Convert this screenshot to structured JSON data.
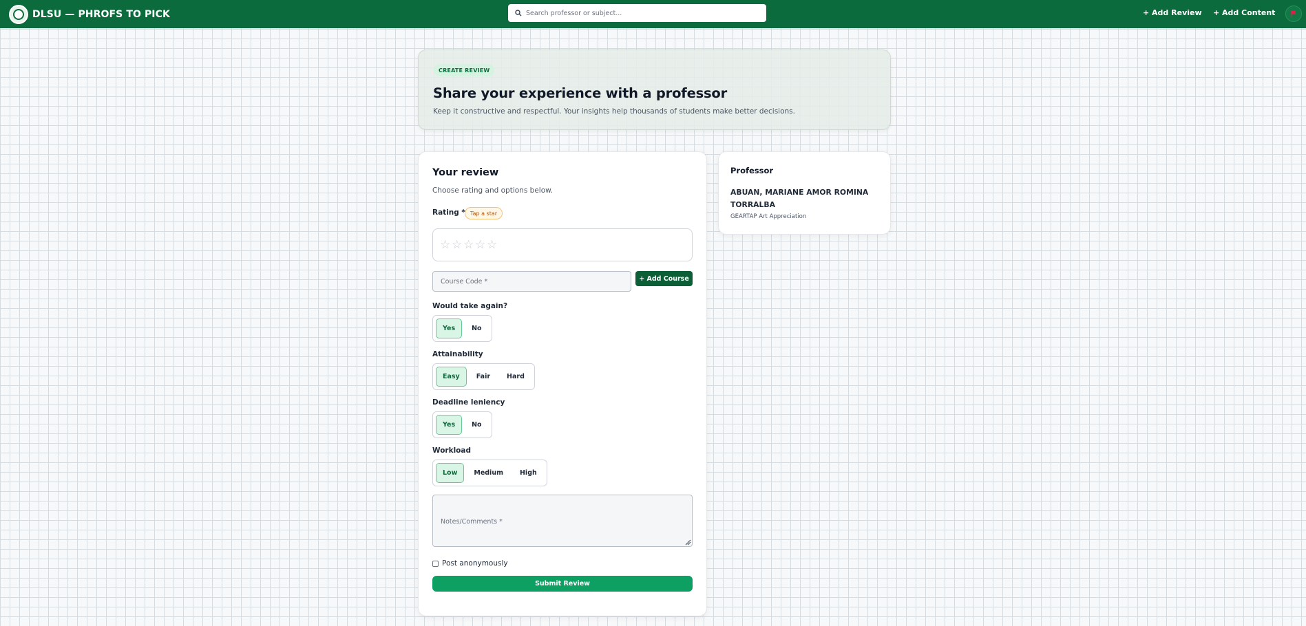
{
  "header": {
    "brand": "DLSU — PHROFS TO PICK",
    "search_placeholder": "Search professor or subject...",
    "nav": {
      "add_review": "+ Add Review",
      "add_content": "+ Add Content"
    },
    "bar_color": "#0b6b3c"
  },
  "hero": {
    "badge": "CREATE REVIEW",
    "title": "Share your experience with a professor",
    "subtitle": "Keep it constructive and respectful. Your insights help thousands of students make better decisions."
  },
  "review": {
    "title": "Your review",
    "subtitle": "Choose rating and options below.",
    "rating_label": "Rating *",
    "rating_hint": "Tap a star",
    "rating_value": 0,
    "rating_max": 5,
    "course_placeholder": "Course Code *",
    "add_course_label": "+ Add Course",
    "take_again": {
      "label": "Would take again?",
      "options": [
        "Yes",
        "No"
      ],
      "selected": "Yes"
    },
    "attainability": {
      "label": "Attainability",
      "options": [
        "Easy",
        "Fair",
        "Hard"
      ],
      "selected": "Easy"
    },
    "deadline": {
      "label": "Deadline leniency",
      "options": [
        "Yes",
        "No"
      ],
      "selected": "Yes"
    },
    "workload": {
      "label": "Workload",
      "options": [
        "Low",
        "Medium",
        "High"
      ],
      "selected": "Low"
    },
    "notes_placeholder": "Notes/Comments *",
    "anonymous_label": "Post anonymously",
    "anonymous_checked": false,
    "submit_label": "Submit Review"
  },
  "professor": {
    "title": "Professor",
    "name": "ABUAN, MARIANE AMOR ROMINA TORRALBA",
    "course": "GEARTAP Art Appreciation"
  },
  "colors": {
    "accent": "#0e9f62",
    "dark_green": "#0b5e36",
    "selected_bg": "#d9f5e5"
  }
}
